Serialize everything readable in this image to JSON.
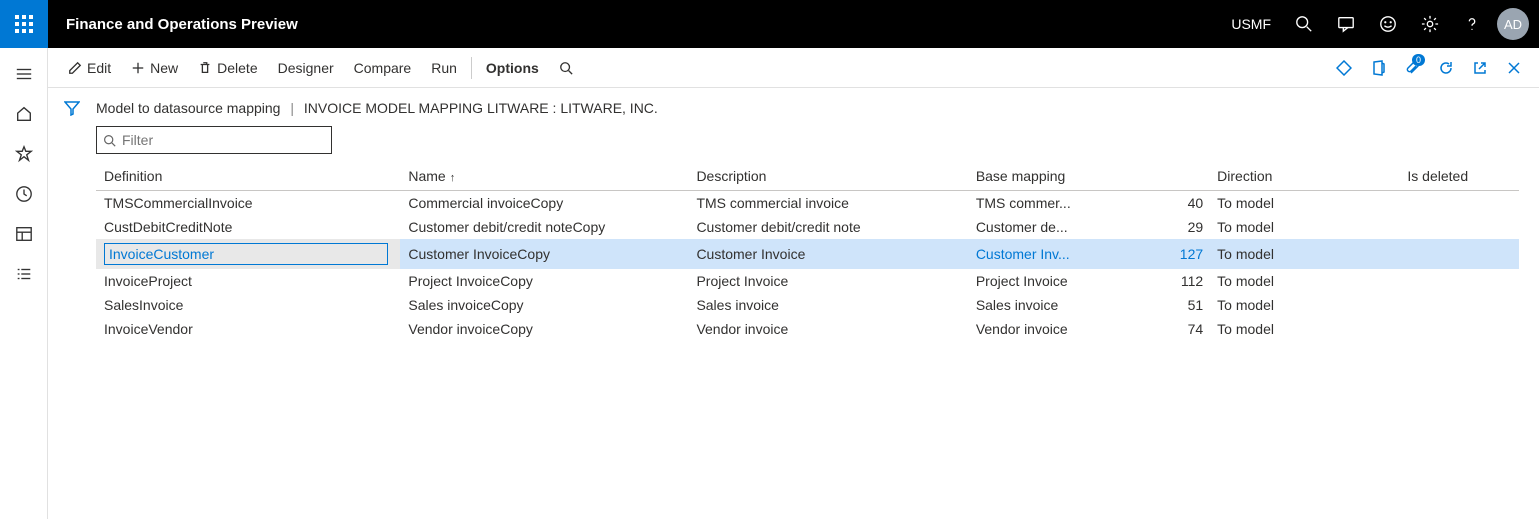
{
  "header": {
    "app_title": "Finance and Operations Preview",
    "company": "USMF",
    "avatar": "AD",
    "attach_badge": "0"
  },
  "cmdbar": {
    "edit": "Edit",
    "new": "New",
    "delete": "Delete",
    "designer": "Designer",
    "compare": "Compare",
    "run": "Run",
    "options": "Options"
  },
  "breadcrumb": {
    "a": "Model to datasource mapping",
    "b": "INVOICE MODEL MAPPING LITWARE : LITWARE, INC."
  },
  "filter": {
    "placeholder": "Filter"
  },
  "columns": {
    "definition": "Definition",
    "name": "Name",
    "description": "Description",
    "base_mapping": "Base mapping",
    "direction": "Direction",
    "is_deleted": "Is deleted"
  },
  "rows": [
    {
      "definition": "TMSCommercialInvoice",
      "name": "Commercial invoiceCopy",
      "description": "TMS commercial invoice",
      "base_mapping": "TMS commer...",
      "base_n": "40",
      "direction": "To model",
      "is_deleted": "",
      "selected": false
    },
    {
      "definition": "CustDebitCreditNote",
      "name": "Customer debit/credit noteCopy",
      "description": "Customer debit/credit note",
      "base_mapping": "Customer de...",
      "base_n": "29",
      "direction": "To model",
      "is_deleted": "",
      "selected": false
    },
    {
      "definition": "InvoiceCustomer",
      "name": "Customer InvoiceCopy",
      "description": "Customer Invoice",
      "base_mapping": "Customer Inv...",
      "base_n": "127",
      "direction": "To model",
      "is_deleted": "",
      "selected": true
    },
    {
      "definition": "InvoiceProject",
      "name": "Project InvoiceCopy",
      "description": "Project Invoice",
      "base_mapping": "Project Invoice",
      "base_n": "112",
      "direction": "To model",
      "is_deleted": "",
      "selected": false
    },
    {
      "definition": "SalesInvoice",
      "name": "Sales invoiceCopy",
      "description": "Sales invoice",
      "base_mapping": "Sales invoice",
      "base_n": "51",
      "direction": "To model",
      "is_deleted": "",
      "selected": false
    },
    {
      "definition": "InvoiceVendor",
      "name": "Vendor invoiceCopy",
      "description": "Vendor invoice",
      "base_mapping": "Vendor invoice",
      "base_n": "74",
      "direction": "To model",
      "is_deleted": "",
      "selected": false
    }
  ]
}
